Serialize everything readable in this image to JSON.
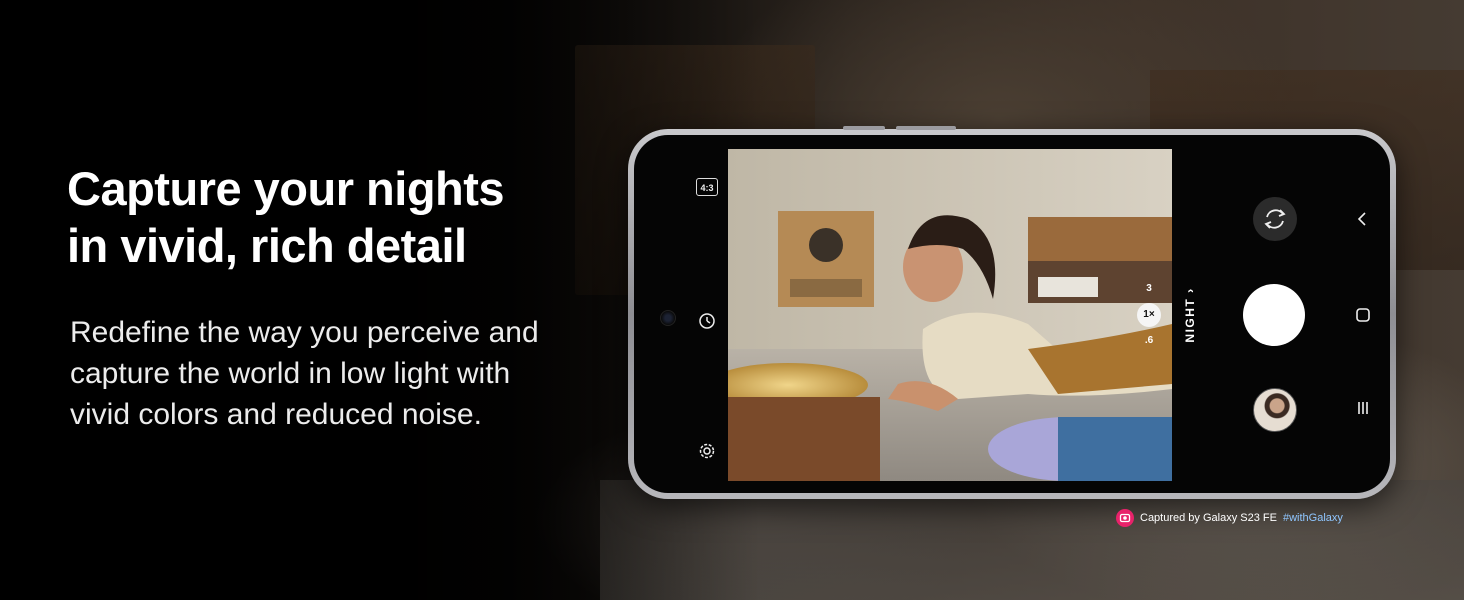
{
  "headline": {
    "line1": "Capture your nights",
    "line2": "in vivid, rich detail"
  },
  "body": {
    "line1": "Redefine the way you perceive and",
    "line2": "capture the world in low light with",
    "line3": "vivid colors and reduced noise."
  },
  "camera_ui": {
    "aspect_ratio": "4:3",
    "mode": "NIGHT",
    "zoom_levels": [
      "3",
      "1×",
      ".6"
    ],
    "icons": [
      "timer-icon",
      "settings-icon",
      "flip-camera-icon",
      "shutter-button",
      "gallery-thumbnail",
      "back-nav-icon",
      "home-nav-icon",
      "recents-nav-icon"
    ]
  },
  "caption": {
    "text": "Captured by Galaxy S23 FE",
    "hashtag": "#withGalaxy"
  },
  "colors": {
    "background": "#000000",
    "headline": "#ffffff",
    "hashtag": "#8fc6ff",
    "badge": "#e8226a"
  }
}
